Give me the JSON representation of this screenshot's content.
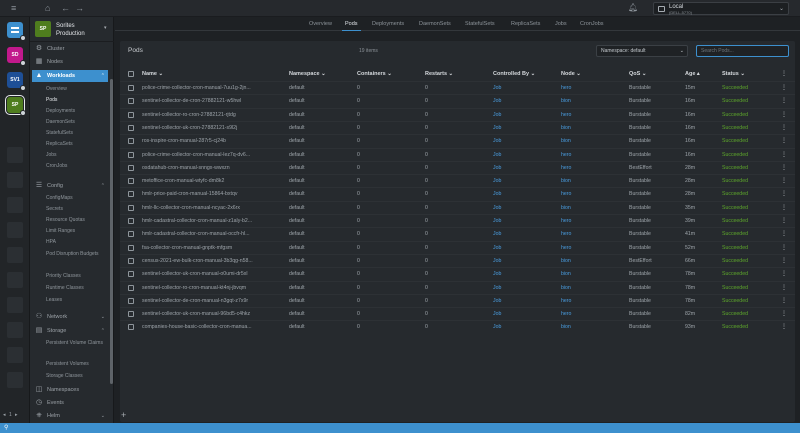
{
  "window": {
    "cluster_name": "Local",
    "cluster_sub": "(DELL-5770)"
  },
  "hotbar": [
    {
      "label": "",
      "color": "#3d90ce"
    },
    {
      "label": "SD",
      "color": "#c2198c"
    },
    {
      "label": "SV1",
      "color": "#1e4f96"
    },
    {
      "label": "SP",
      "color": "#4f7d1e"
    }
  ],
  "sidebar": {
    "cluster_logo": "SP",
    "cluster_name": "Sorites Production",
    "items": [
      {
        "label": "Cluster",
        "icon": "cluster-icon"
      },
      {
        "label": "Nodes",
        "icon": "nodes-icon"
      },
      {
        "label": "Workloads",
        "icon": "workloads-icon"
      },
      {
        "label": "Config",
        "icon": "config-icon"
      },
      {
        "label": "Network",
        "icon": "network-icon"
      },
      {
        "label": "Storage",
        "icon": "storage-icon"
      },
      {
        "label": "Namespaces",
        "icon": "namespaces-icon"
      },
      {
        "label": "Events",
        "icon": "events-icon"
      },
      {
        "label": "Helm",
        "icon": "helm-icon"
      }
    ],
    "workloads_sub": [
      "Overview",
      "Pods",
      "Deployments",
      "DaemonSets",
      "StatefulSets",
      "ReplicaSets",
      "Jobs",
      "CronJobs"
    ],
    "config_sub": [
      "ConfigMaps",
      "Secrets",
      "Resource Quotas",
      "Limit Ranges",
      "HPA",
      "Pod Disruption Budgets",
      "Priority Classes",
      "Runtime Classes",
      "Leases"
    ],
    "storage_sub": [
      "Persistent Volume Claims",
      "Persistent Volumes",
      "Storage Classes"
    ]
  },
  "tabs": [
    "Overview",
    "Pods",
    "Deployments",
    "DaemonSets",
    "StatefulSets",
    "ReplicaSets",
    "Jobs",
    "CronJobs"
  ],
  "active_tab": "Pods",
  "panel": {
    "title": "Pods",
    "count": "19 items",
    "namespace_select": "Namespace: default",
    "search_placeholder": "Search Pods..."
  },
  "table": {
    "headers": [
      "Name",
      "Namespace",
      "Containers",
      "Restarts",
      "Controlled By",
      "Node",
      "QoS",
      "Age",
      "Status"
    ],
    "rows": [
      [
        "police-crime-collector-cron-manual-7uu1g-2jn...",
        "default",
        "0",
        "0",
        "Job",
        "hero",
        "Burstable",
        "15m",
        "Succeeded"
      ],
      [
        "sentinel-collector-de-cron-27882121-w5hwl",
        "default",
        "0",
        "0",
        "Job",
        "bion",
        "Burstable",
        "16m",
        "Succeeded"
      ],
      [
        "sentinel-collector-ro-cron-27882121-rjtdg",
        "default",
        "0",
        "0",
        "Job",
        "hero",
        "Burstable",
        "16m",
        "Succeeded"
      ],
      [
        "sentinel-collector-uk-cron-27882121-s9l2j",
        "default",
        "0",
        "0",
        "Job",
        "bion",
        "Burstable",
        "16m",
        "Succeeded"
      ],
      [
        "ros-inspire-cron-manual-287r5-cj24b",
        "default",
        "0",
        "0",
        "Job",
        "bion",
        "Burstable",
        "16m",
        "Succeeded"
      ],
      [
        "police-crime-collector-cron-manual-lez7q-dv6...",
        "default",
        "0",
        "0",
        "Job",
        "hero",
        "Burstable",
        "16m",
        "Succeeded"
      ],
      [
        "osdatahub-cron-manual-snngx-wwxzn",
        "default",
        "0",
        "0",
        "Job",
        "hero",
        "BestEffort",
        "28m",
        "Succeeded"
      ],
      [
        "metoffice-cron-manual-wtyfc-dm8k2",
        "default",
        "0",
        "0",
        "Job",
        "bion",
        "Burstable",
        "28m",
        "Succeeded"
      ],
      [
        "hmlr-price-paid-cron-manual-15864-bxtqv",
        "default",
        "0",
        "0",
        "Job",
        "hero",
        "Burstable",
        "28m",
        "Succeeded"
      ],
      [
        "hmlr-llc-collector-cron-manual-ncyac-2x6rx",
        "default",
        "0",
        "0",
        "Job",
        "bion",
        "Burstable",
        "35m",
        "Succeeded"
      ],
      [
        "hmlr-cadastral-collector-cron-manual-z1aly-b2...",
        "default",
        "0",
        "0",
        "Job",
        "hero",
        "Burstable",
        "39m",
        "Succeeded"
      ],
      [
        "hmlr-cadastral-collector-cron-manual-occfr-hl...",
        "default",
        "0",
        "0",
        "Job",
        "hero",
        "Burstable",
        "41m",
        "Succeeded"
      ],
      [
        "fsa-collector-cron-manual-gnptk-mfgsm",
        "default",
        "0",
        "0",
        "Job",
        "hero",
        "Burstable",
        "52m",
        "Succeeded"
      ],
      [
        "census-2021-ew-bulk-cron-manual-3b3qg-n58...",
        "default",
        "0",
        "0",
        "Job",
        "bion",
        "BestEffort",
        "66m",
        "Succeeded"
      ],
      [
        "sentinel-collector-uk-cron-manual-o0umi-dr5xl",
        "default",
        "0",
        "0",
        "Job",
        "bion",
        "Burstable",
        "78m",
        "Succeeded"
      ],
      [
        "sentinel-collector-ro-cron-manual-kt4nj-jbvqm",
        "default",
        "0",
        "0",
        "Job",
        "bion",
        "Burstable",
        "78m",
        "Succeeded"
      ],
      [
        "sentinel-collector-de-cron-manual-n3gqt-z7x9r",
        "default",
        "0",
        "0",
        "Job",
        "hero",
        "Burstable",
        "78m",
        "Succeeded"
      ],
      [
        "sentinel-collector-uk-cron-manual-96bd5-c4hkz",
        "default",
        "0",
        "0",
        "Job",
        "hero",
        "Burstable",
        "82m",
        "Succeeded"
      ],
      [
        "companies-house-basic-collector-cron-manua...",
        "default",
        "0",
        "0",
        "Job",
        "bion",
        "Burstable",
        "93m",
        "Succeeded"
      ]
    ]
  },
  "colors": {
    "accent": "#3d90ce",
    "success": "#5ea82b",
    "link": "#4a9de0"
  }
}
